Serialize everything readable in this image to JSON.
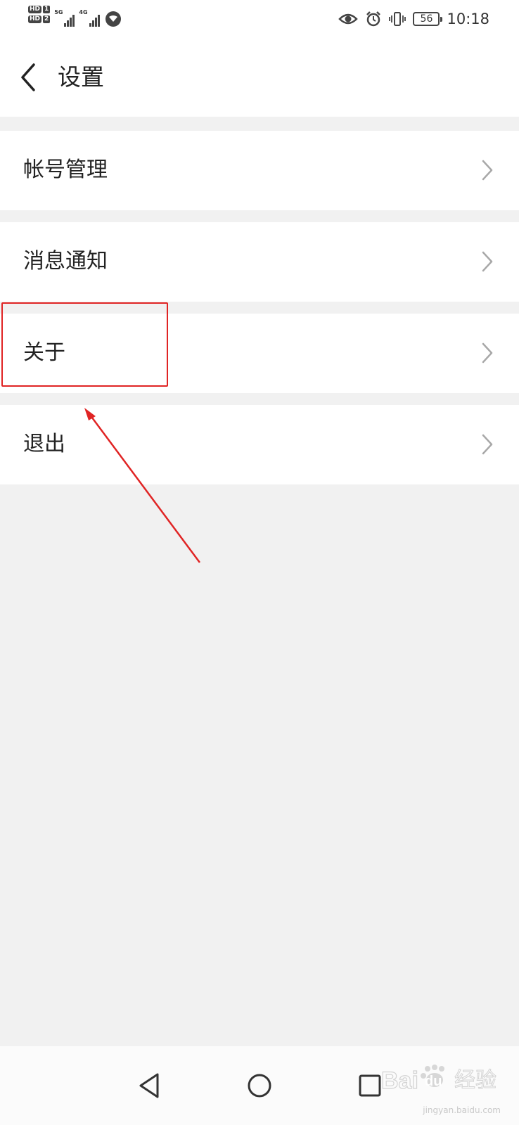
{
  "status_bar": {
    "sim1": {
      "hd": "HD",
      "num": "1"
    },
    "sim2": {
      "hd": "HD",
      "num": "2"
    },
    "net1": "5G",
    "net2": "4G",
    "battery": "56",
    "time": "10:18",
    "icons": [
      "eye-icon",
      "alarm-icon",
      "vibrate-icon",
      "battery-icon",
      "signal-icon",
      "wifi-icon"
    ]
  },
  "header": {
    "title": "设置",
    "back_icon": "chevron-left-icon"
  },
  "settings": {
    "items": [
      {
        "label": "帐号管理"
      },
      {
        "label": "消息通知"
      },
      {
        "label": "关于"
      },
      {
        "label": "退出"
      }
    ]
  },
  "annotation": {
    "highlight_color": "#e02424",
    "target": "关于"
  },
  "nav_bar": {
    "icons": [
      "back-triangle-icon",
      "home-circle-icon",
      "recents-square-icon"
    ]
  },
  "watermark": {
    "brand": "Bai",
    "brand2": "du",
    "text": "经验",
    "url": "jingyan.baidu.com"
  }
}
